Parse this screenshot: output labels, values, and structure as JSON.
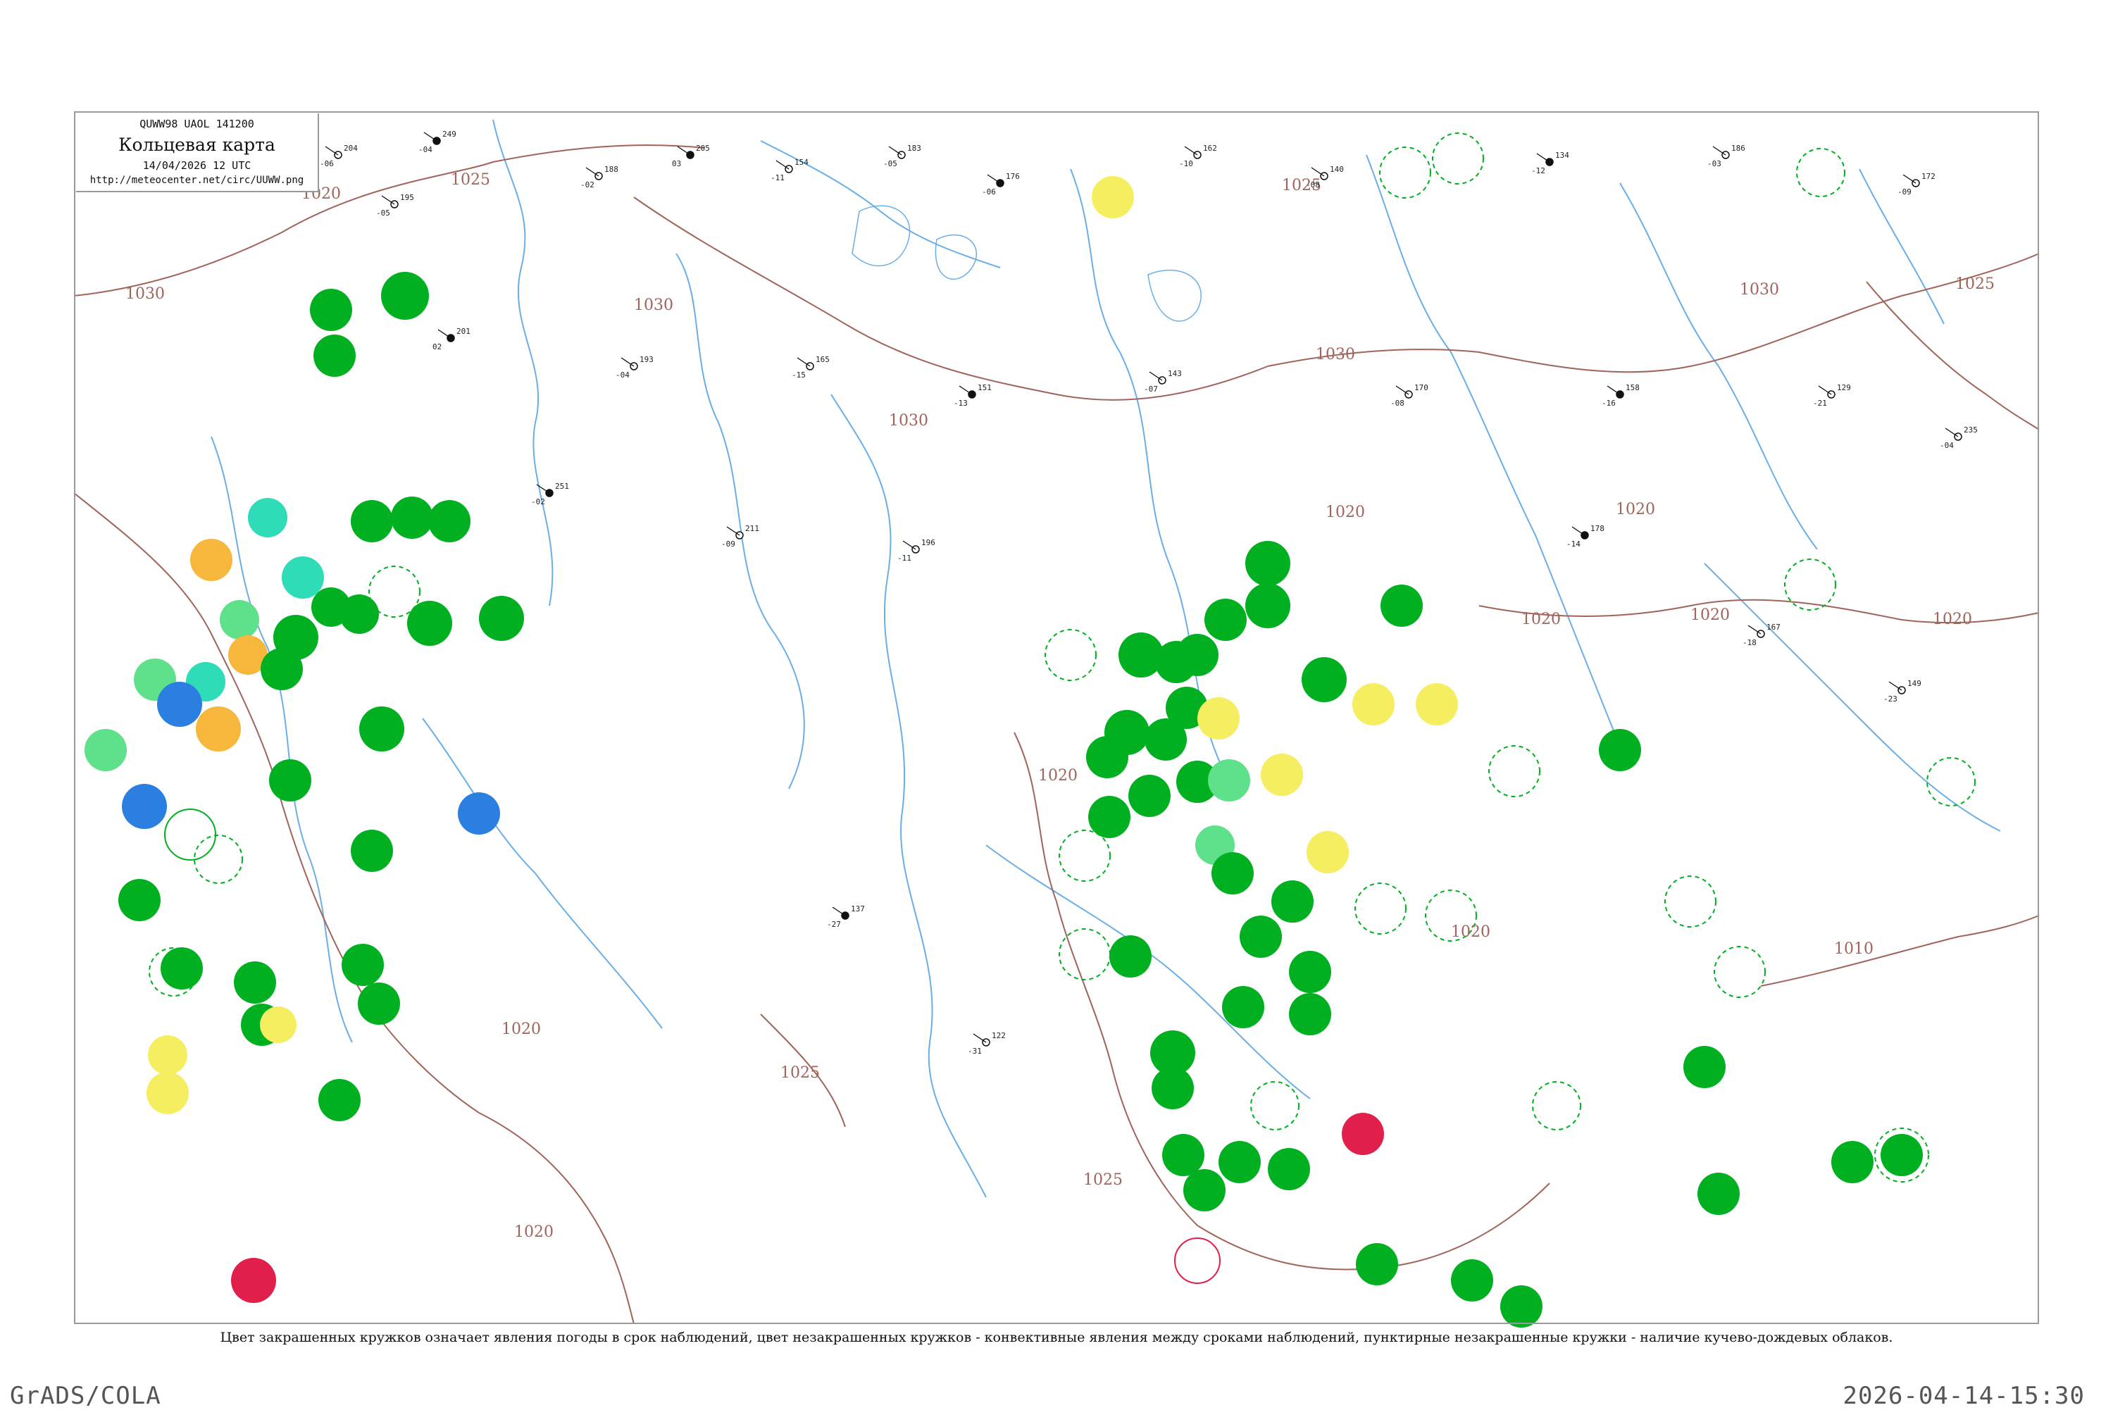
{
  "legend": {
    "code": "QUWW98  UAOL  141200",
    "title": "Кольцевая карта",
    "date": "14/04/2026 12 UTC",
    "url": "http://meteocenter.net/circ/UUWW.png"
  },
  "caption": "Цвет закрашенных кружков означает явления погоды в срок наблюдений, цвет незакрашенных кружков - конвективные явления между сроками наблюдений, пунктирные незакрашенные кружки - наличие кучево-дождевых облаков.",
  "footer": {
    "left": "GrADS/COLA",
    "right": "2026-04-14-15:30"
  },
  "colors": {
    "rain": "#00b020",
    "shower": "#00c040",
    "snow": "#2b7fe0",
    "fog": "#f6b73c",
    "drizzle": "#f5ee60",
    "cyan": "#2fdcb8",
    "light_green": "#5fe08a",
    "thunder": "#e0204a",
    "isobar": "#a0645a",
    "river": "#6aaee8"
  },
  "isobars": [
    {
      "label": "1025"
    },
    {
      "label": "1020"
    },
    {
      "label": "1030"
    },
    {
      "label": "1025"
    },
    {
      "label": "1030"
    },
    {
      "label": "1030"
    },
    {
      "label": "1020"
    },
    {
      "label": "1020"
    },
    {
      "label": "1020"
    },
    {
      "label": "1025"
    },
    {
      "label": "1020"
    },
    {
      "label": "1030"
    },
    {
      "label": "1025"
    },
    {
      "label": "1020"
    },
    {
      "label": "1025"
    },
    {
      "label": "1010"
    },
    {
      "label": "1020"
    },
    {
      "label": "1020"
    },
    {
      "label": "1020"
    },
    {
      "label": "1030"
    },
    {
      "label": "1020"
    }
  ],
  "stations": [
    {
      "t": "204",
      "p": "-06",
      "w": "0"
    },
    {
      "t": "249",
      "p": "-04",
      "w": "1"
    },
    {
      "t": "195",
      "p": "-05",
      "w": "2"
    },
    {
      "t": "188",
      "p": "-02",
      "w": "0"
    },
    {
      "t": "205",
      "p": "03",
      "w": "1"
    },
    {
      "t": "154",
      "p": "-11",
      "w": "2"
    },
    {
      "t": "183",
      "p": "-05",
      "w": "0"
    },
    {
      "t": "176",
      "p": "-06",
      "w": "1"
    },
    {
      "t": "162",
      "p": "-10",
      "w": "2"
    },
    {
      "t": "140",
      "p": "-08",
      "w": "0"
    },
    {
      "t": "134",
      "p": "-12",
      "w": "1"
    },
    {
      "t": "186",
      "p": "-03",
      "w": "2"
    },
    {
      "t": "172",
      "p": "-09",
      "w": "0"
    },
    {
      "t": "201",
      "p": "02",
      "w": "1"
    },
    {
      "t": "193",
      "p": "-04",
      "w": "2"
    },
    {
      "t": "165",
      "p": "-15",
      "w": "0"
    },
    {
      "t": "151",
      "p": "-13",
      "w": "1"
    },
    {
      "t": "143",
      "p": "-07",
      "w": "2"
    },
    {
      "t": "170",
      "p": "-08",
      "w": "0"
    },
    {
      "t": "158",
      "p": "-16",
      "w": "1"
    },
    {
      "t": "129",
      "p": "-21",
      "w": "2"
    },
    {
      "t": "235",
      "p": "-04",
      "w": "0"
    },
    {
      "t": "251",
      "p": "-02",
      "w": "1"
    },
    {
      "t": "211",
      "p": "-09",
      "w": "2"
    },
    {
      "t": "196",
      "p": "-11",
      "w": "0"
    },
    {
      "t": "178",
      "p": "-14",
      "w": "1"
    },
    {
      "t": "167",
      "p": "-18",
      "w": "2"
    },
    {
      "t": "149",
      "p": "-23",
      "w": "0"
    },
    {
      "t": "137",
      "p": "-27",
      "w": "1"
    },
    {
      "t": "122",
      "p": "-31",
      "w": "2"
    }
  ]
}
